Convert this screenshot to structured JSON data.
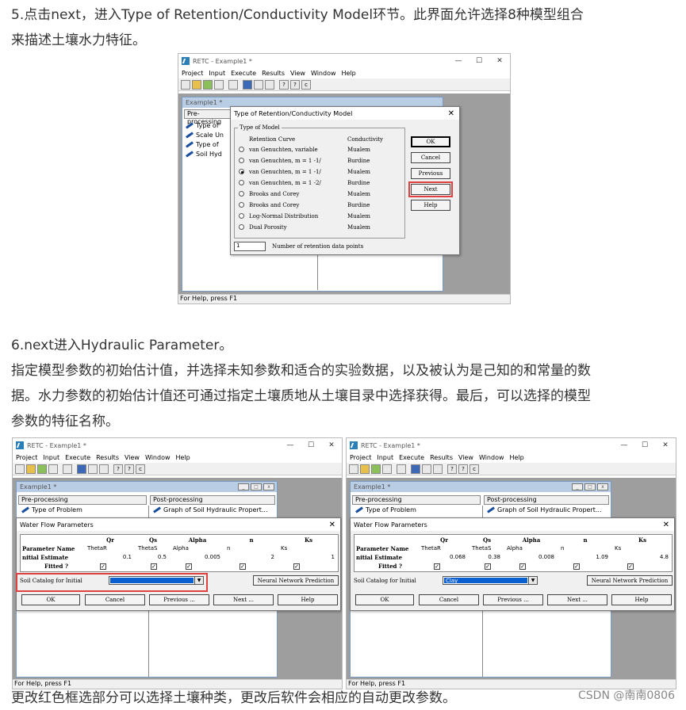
{
  "article": {
    "p5": "5.点击next，进入Type of Retention/Conductivity Model环节。此界面允许选择8种模型组合",
    "p5b": "来描述土壤水力特征。",
    "p6": "6.next进入Hydraulic Parameter。",
    "p7a": "指定模型参数的初始估计值，并选择未知参数和适合的实验数据，以及被认为是己知的和常量的数",
    "p7b": "据。水力参数的初始估计值还可通过指定土壤质地从土壤目录中选择获得。最后，可以选择的模型",
    "p7c": "参数的特征名称。",
    "p8": "更改红色框选部分可以选择土壤种类，更改后软件会相应的自动更改参数。",
    "watermark": "CSDN @南南0806"
  },
  "app": {
    "title": "RETC - Example1 *",
    "child_title": "Example1 *",
    "menu": [
      "Project",
      "Input",
      "Execute",
      "Results",
      "View",
      "Window",
      "Help"
    ],
    "status": "For Help, press F1",
    "preprocessing": "Pre-processing",
    "postprocessing": "Post-processing",
    "post_item": "Graph of Soil Hydraulic Propert...",
    "tree_short": [
      "Type of",
      "Scale Un",
      "Type of",
      "Soil Hyd"
    ],
    "tree_first": "Type of Problem",
    "child_abbrev": "Pre-processing"
  },
  "model_dialog": {
    "title": "Type of Retention/Conductivity Model",
    "group": "Type of Model",
    "col_retention": "Retention Curve",
    "col_conductivity": "Conductivity",
    "options": [
      {
        "label": "van Genuchten, variable",
        "cond": "Mualem",
        "selected": false
      },
      {
        "label": "van Genuchten, m = 1 -1/",
        "cond": "Burdine",
        "selected": false
      },
      {
        "label": "van Genuchten, m = 1 -1/",
        "cond": "Mualem",
        "selected": true
      },
      {
        "label": "van Genuchten, m = 1 -2/",
        "cond": "Burdine",
        "selected": false
      },
      {
        "label": "Brooks and Corey",
        "cond": "Mualem",
        "selected": false
      },
      {
        "label": "Brooks and Corey",
        "cond": "Burdine",
        "selected": false
      },
      {
        "label": "Log-Normal Distribution",
        "cond": "Mualem",
        "selected": false
      },
      {
        "label": "Dual Porosity",
        "cond": "Mualem",
        "selected": false
      }
    ],
    "points_value": "1",
    "points_label": "Number of retention data points",
    "buttons": {
      "ok": "OK",
      "cancel": "Cancel",
      "previous": "Previous",
      "next": "Next",
      "help": "Help"
    }
  },
  "wfp_left": {
    "title": "Water Flow Parameters",
    "headers": [
      "Qr",
      "Qs",
      "Alpha",
      "n",
      "Ks"
    ],
    "row_names": [
      "Parameter Name",
      "nitial Estimate",
      "Fitted ?"
    ],
    "names": [
      "ThetaR",
      "ThetaS",
      "Alpha",
      "n",
      "Ks"
    ],
    "estimates": [
      "0.1",
      "0.5",
      "0.005",
      "2",
      "1"
    ],
    "catalog_label": "Soil Catalog for Initial",
    "catalog_value": "",
    "neural": "Neural Network Prediction",
    "buttons": {
      "ok": "OK",
      "cancel": "Cancel",
      "previous": "Previous ...",
      "next": "Next ...",
      "help": "Help"
    }
  },
  "wfp_right": {
    "title": "Water Flow Parameters",
    "headers": [
      "Qr",
      "Qs",
      "Alpha",
      "n",
      "Ks"
    ],
    "row_names": [
      "Parameter Name",
      "nitial Estimate",
      "Fitted ?"
    ],
    "names": [
      "ThetaR",
      "ThetaS",
      "Alpha",
      "n",
      "Ks"
    ],
    "estimates": [
      "0.068",
      "0.38",
      "0.008",
      "1.09",
      "4.8"
    ],
    "catalog_label": "Soil Catalog for Initial",
    "catalog_value": "Clay",
    "neural": "Neural Network Prediction",
    "buttons": {
      "ok": "OK",
      "cancel": "Cancel",
      "previous": "Previous ...",
      "next": "Next ...",
      "help": "Help"
    }
  },
  "colors": {
    "highlight_red": "#e04040",
    "selection_blue": "#0a5fd0",
    "mdi_gray": "#9e9e9e"
  }
}
